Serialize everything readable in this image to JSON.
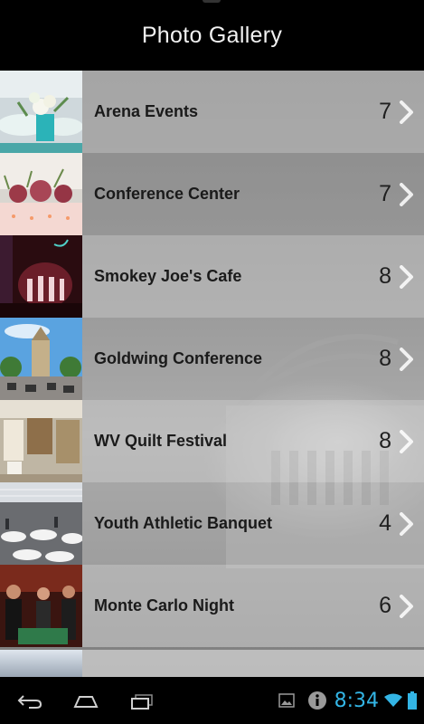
{
  "header": {
    "title": "Photo Gallery"
  },
  "gallery": {
    "items": [
      {
        "label": "Arena Events",
        "count": "7"
      },
      {
        "label": "Conference Center",
        "count": "7"
      },
      {
        "label": "Smokey Joe's Cafe",
        "count": "8"
      },
      {
        "label": "Goldwing Conference",
        "count": "8"
      },
      {
        "label": "WV Quilt Festival",
        "count": "8"
      },
      {
        "label": "Youth Athletic Banquet",
        "count": "4"
      },
      {
        "label": "Monte Carlo Night",
        "count": "6"
      }
    ]
  },
  "statusbar": {
    "time": "8:34"
  },
  "colors": {
    "clock": "#33b5e5",
    "header_bg": "#000000",
    "row_text": "#1a1a1a"
  }
}
